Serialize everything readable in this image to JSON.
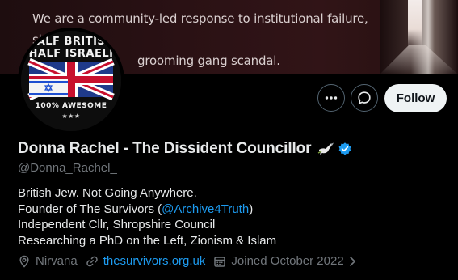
{
  "banner": {
    "line1": "We are a community-led response to institutional failure, shining a",
    "line2": "grooming gang scandal."
  },
  "avatar": {
    "top_text_1": "HALF BRITISH",
    "top_text_2": "HALF ISRAELI",
    "bottom_text": "100% AWESOME",
    "stars": "★★★"
  },
  "actions": {
    "more_icon": "more-horizontal-icon",
    "message_icon": "message-bubble-icon",
    "follow_label": "Follow"
  },
  "profile": {
    "display_name": "Donna Rachel - The Dissident Councillor",
    "handle": "@Donna_Rachel_",
    "bio_line1": "British Jew. Not Going Anywhere.",
    "bio_line2_prefix": "Founder of The Survivors (",
    "bio_line2_link": "@Archive4Truth",
    "bio_line2_suffix": ")",
    "bio_line3": "Independent Cllr, Shropshire Council",
    "bio_line4": "Researching a PhD on the Left, Zionism & Islam",
    "location": "Nirvana",
    "website": "thesurvivors.org.uk",
    "joined": "Joined October 2022"
  },
  "colors": {
    "accent": "#1d9bf0",
    "muted": "#71767b",
    "text": "#e7e9ea",
    "background": "#000000"
  }
}
